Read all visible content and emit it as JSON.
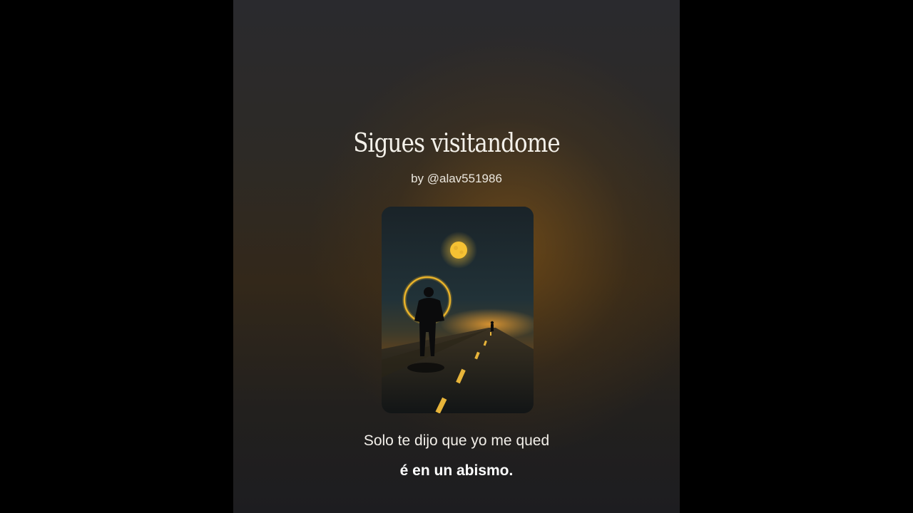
{
  "song": {
    "title": "Sigues visitandome",
    "author": "by @alav551986"
  },
  "cover_art": {
    "icon": "cover-art-image",
    "moon_color": "#f6c233",
    "halo_color": "#e8b22a"
  },
  "lyrics": {
    "line_1": "Solo te dijo que yo me qued",
    "line_2": "é en un abismo."
  }
}
